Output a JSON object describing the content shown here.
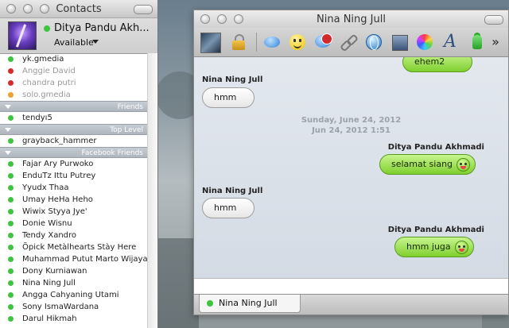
{
  "colors": {
    "online": "#3ec43e",
    "busy": "#d62b2b",
    "away": "#f0a030",
    "my_bubble": "#8fd84a",
    "their_bubble": "#ffffff"
  },
  "contacts": {
    "title": "Contacts",
    "account": {
      "name": "Ditya Pandu Akh...",
      "status": "Available"
    },
    "rows": [
      {
        "type": "contact",
        "name": "yk.gmedia",
        "status": "online"
      },
      {
        "type": "contact",
        "name": "Anggie David",
        "status": "busy"
      },
      {
        "type": "contact",
        "name": "chandra putri",
        "status": "busy"
      },
      {
        "type": "contact",
        "name": "solo.gmedia",
        "status": "away"
      },
      {
        "type": "group",
        "name": "Friends"
      },
      {
        "type": "contact",
        "name": "tendyı5",
        "status": "online"
      },
      {
        "type": "group",
        "name": "Top Level"
      },
      {
        "type": "contact",
        "name": "grayback_hammer",
        "status": "online"
      },
      {
        "type": "group",
        "name": "Facebook Friends"
      },
      {
        "type": "contact",
        "name": "Fajar Ary Purwoko",
        "status": "online"
      },
      {
        "type": "contact",
        "name": "EnduTz Ittu Putrey",
        "status": "online"
      },
      {
        "type": "contact",
        "name": "Yyudx Thaa",
        "status": "online"
      },
      {
        "type": "contact",
        "name": "Umay HeHa Heho",
        "status": "online"
      },
      {
        "type": "contact",
        "name": "Wiwix Styya Jye'",
        "status": "online"
      },
      {
        "type": "contact",
        "name": "Donie Wisnu",
        "status": "online"
      },
      {
        "type": "contact",
        "name": "Tendy Xandro",
        "status": "online"
      },
      {
        "type": "contact",
        "name": "Öpick Metàlhearts Stày Here",
        "status": "online"
      },
      {
        "type": "contact",
        "name": "Muhammad Putut Marto Wijaya",
        "status": "online"
      },
      {
        "type": "contact",
        "name": "Dony Kurniawan",
        "status": "online"
      },
      {
        "type": "contact",
        "name": "Nina Ning Jull",
        "status": "online"
      },
      {
        "type": "contact",
        "name": "Angga Cahyaning Utami",
        "status": "online"
      },
      {
        "type": "contact",
        "name": "Sony IsmaWardana",
        "status": "online"
      },
      {
        "type": "contact",
        "name": "Darul Hikmah",
        "status": "online"
      }
    ]
  },
  "chat": {
    "title": "Nina Ning Jull",
    "toolbar": [
      "buddy-photo-icon",
      "encryption-lock-icon",
      "send-im-icon",
      "insert-emoticon-icon",
      "block-icon",
      "insert-link-icon",
      "web-browser-icon",
      "insert-image-icon",
      "color-picker-icon",
      "font-icon",
      "user-info-icon",
      "more-icon"
    ],
    "messages": {
      "m1": "ehem2",
      "m2_sender": "Nina Ning Jull",
      "m2": "hmm",
      "date_line1": "Sunday, June 24, 2012",
      "date_line2": "Jun 24, 2012 1:51",
      "m3_sender": "Ditya Pandu Akhmadi",
      "m3": "selamat siang",
      "m4_sender": "Nina Ning Jull",
      "m4": "hmm",
      "m5_sender": "Ditya Pandu Akhmadi",
      "m5": "hmm juga"
    },
    "input_value": "",
    "tab_label": "Nina Ning Jull",
    "more_label": "»"
  }
}
